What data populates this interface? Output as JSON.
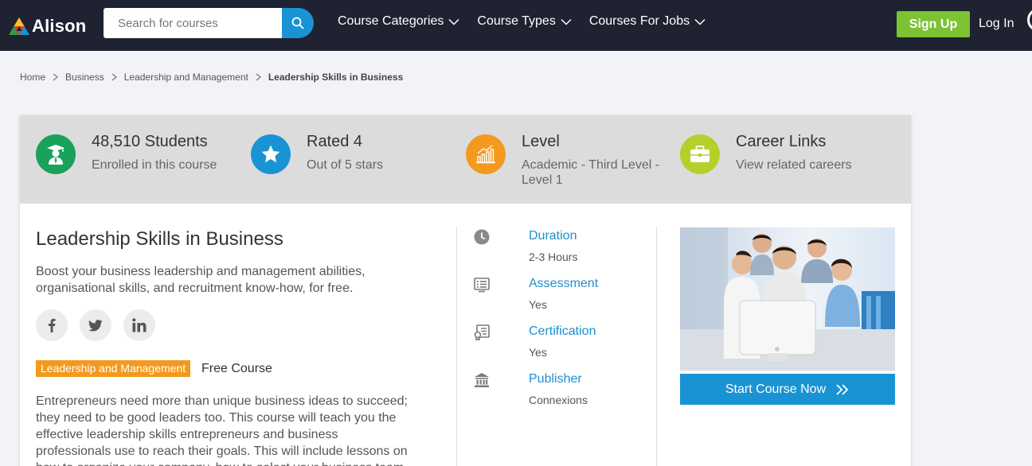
{
  "header": {
    "logo_text": "Alison",
    "search_placeholder": "Search for courses",
    "nav": [
      {
        "label": "Course Categories"
      },
      {
        "label": "Course Types"
      },
      {
        "label": "Courses For Jobs"
      }
    ],
    "signup_label": "Sign Up",
    "login_label": "Log In"
  },
  "breadcrumb": {
    "items": [
      "Home",
      "Business",
      "Leadership and Management",
      "Leadership Skills in Business"
    ]
  },
  "stats": [
    {
      "title": "48,510 Students",
      "subtitle": "Enrolled in this course",
      "icon": "graduate-icon",
      "color": "#1aa15a"
    },
    {
      "title": "Rated 4",
      "subtitle": "Out of 5 stars",
      "icon": "star-icon",
      "color": "#1a93d4"
    },
    {
      "title": "Level",
      "subtitle": "Academic - Third Level - Level 1",
      "icon": "bar-chart-icon",
      "color": "#f39a1e"
    },
    {
      "title": "Career Links",
      "subtitle": "View related careers",
      "icon": "briefcase-icon",
      "color": "#b7cf2b"
    }
  ],
  "course": {
    "title": "Leadership Skills in Business",
    "subtitle": "Boost your business leadership and management abilities, organisational skills, and recruitment know-how, for free.",
    "tag": "Leadership and Management",
    "type": "Free Course",
    "description": "Entrepreneurs need more than unique business ideas to succeed; they need to be good leaders too. This course will teach you the effective leadership skills entrepreneurs and business professionals use to reach their goals. This will include lessons on how to organize your company, how to select your business team"
  },
  "details": [
    {
      "label": "Duration",
      "value": "2-3 Hours",
      "icon": "clock-icon"
    },
    {
      "label": "Assessment",
      "value": "Yes",
      "icon": "assessment-icon"
    },
    {
      "label": "Certification",
      "value": "Yes",
      "icon": "certificate-icon"
    },
    {
      "label": "Publisher",
      "value": "Connexions",
      "icon": "institution-icon"
    }
  ],
  "cta": {
    "label": "Start Course Now"
  },
  "colors": {
    "accent": "#1a93d4",
    "signup": "#7cc232",
    "topbar": "#1f2230",
    "tag": "#f39a1e"
  }
}
